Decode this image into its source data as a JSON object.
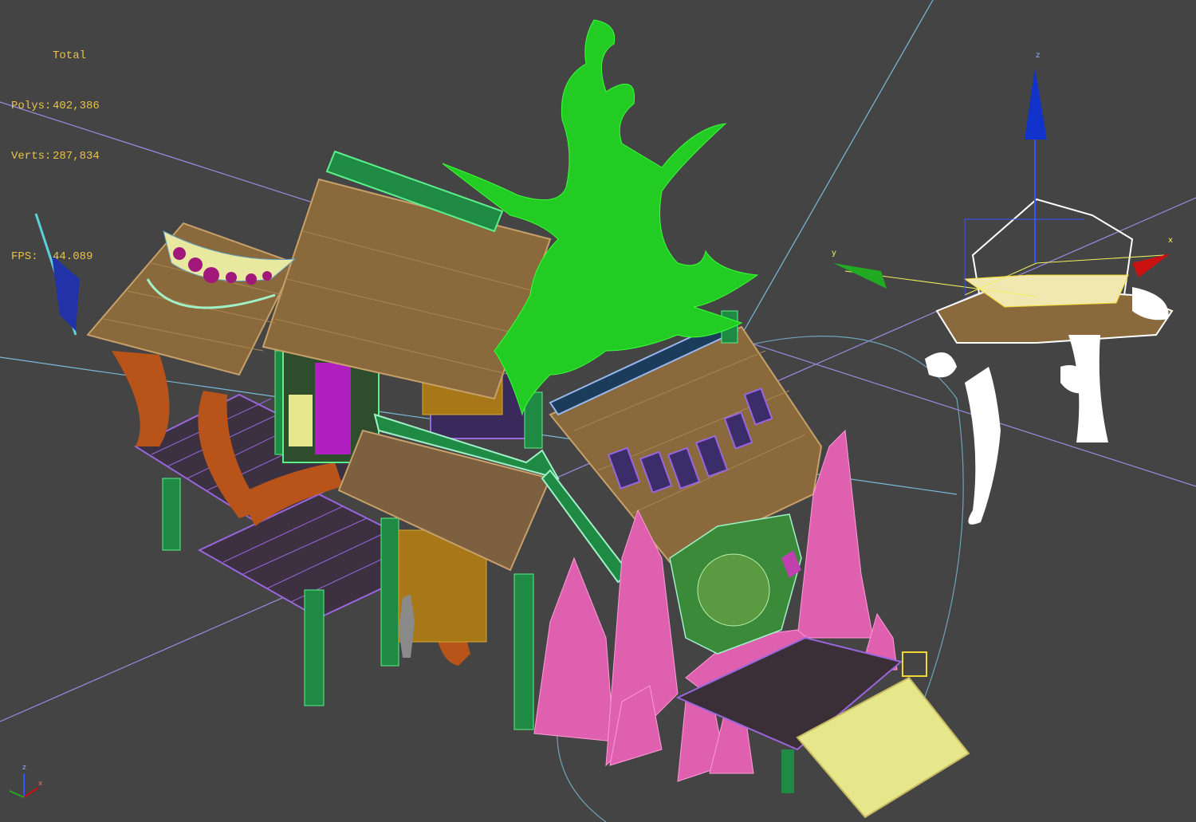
{
  "stats": {
    "total_label": "Total",
    "polys_label": "Polys:",
    "polys_value": "402,386",
    "verts_label": "Verts:",
    "verts_value": "287,834",
    "fps_label": "FPS:",
    "fps_value": "44.089"
  },
  "gizmo": {
    "z_label": "z",
    "y_label": "y",
    "x_label": "x"
  },
  "view_cube": {
    "z_label": "z",
    "x_label": "x"
  },
  "colors": {
    "viewport_bg": "#444444",
    "stats_text": "#e8c24a",
    "gizmo_x": "#cc1111",
    "gizmo_y": "#22aa22",
    "gizmo_z": "#1133cc",
    "tree_wire": "#22cc22",
    "roof_wire": "#8a6a3c",
    "rock_wire": "#e060b0",
    "plank_wire": "#9a66dd",
    "post_wire": "#22bb66",
    "selected_wire": "#ffffff",
    "grid_line": "#9c8ae0"
  }
}
